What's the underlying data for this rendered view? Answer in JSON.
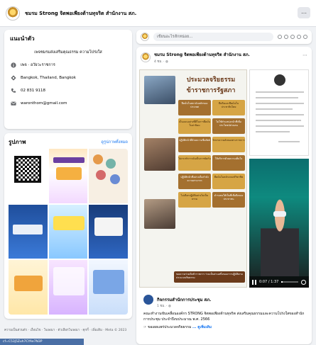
{
  "page": {
    "title": "ชมรม Strong จิตพอเพียงต้านทุจริต สำนักงาน สภ.",
    "more_icon": "more-horizontal-icon"
  },
  "intro": {
    "title": "แนะนำตัว",
    "description": "เพจชมรมส่งเสริมคุณธรรม ความโปร่งใส",
    "rows": [
      {
        "icon": "info-icon",
        "text": "เพจ · อวัยวะราชการ"
      },
      {
        "icon": "location-pin-icon",
        "text": "Bangkok, Thailand, Bangkok"
      },
      {
        "icon": "phone-icon",
        "text": "02 831 9118"
      },
      {
        "icon": "email-icon",
        "text": "waronthom@gmail.com"
      }
    ]
  },
  "photos": {
    "title": "รูปภาพ",
    "see_all": "ดูรูปภาพทั้งหมด",
    "tiles": [
      {
        "caption": ""
      },
      {
        "caption": "รายงานผลการประเมิน"
      },
      {
        "caption": ""
      },
      {
        "caption": "คู่มือการปฏิบัติงาน"
      },
      {
        "caption": "CONTENT"
      },
      {
        "caption": ""
      },
      {
        "caption": ""
      },
      {
        "caption": ""
      },
      {
        "caption": ""
      }
    ]
  },
  "footer": {
    "text": "ความเป็นส่วนตัว · เงื่อนไข · โฆษณา · ตัวเลือกโฆษณา · คุกกี้ · เพิ่มเติม · Meta © 2023",
    "url": "cf=C53j5Zuh7CYAe7N3P"
  },
  "composer": {
    "placeholder": "เขียนอะไรสักหน่อย...",
    "tools": [
      "photo-icon",
      "video-icon",
      "tag-icon",
      "emoji-icon",
      "location-icon"
    ]
  },
  "post": {
    "author": "ชมรม Strong จิตพอเพียงต้านทุจริต สำนักงาน สภ.",
    "time": "4 ชม. · ",
    "poster": {
      "title_line1": "ประมวลจริยธรรม",
      "title_line2": "ข้าราชการรัฐสภา",
      "boxes": [
        "ยึดมั่นในสถาบันหลักของประเทศ",
        "ยึดถือและยึดมั่นในประชาธิปไตย",
        "เป็นแบบอย่างที่ดีในการยึดมั่นในค่านิยม",
        "ไม่ใช้ตำแหน่งหน้าที่เพื่อประโยชน์ส่วนตน",
        "ปฏิบัติหน้าที่ด้วยความซื่อสัตย์",
        "รักษาความลับของทางราชการ",
        "ไม่กระทำการอันเป็นการขัดกัน",
        "ให้บริการด้วยความเต็มใจ",
        "ปฏิบัติหน้าที่อย่างเต็มกำลังความสามารถ",
        "ยึดมั่นในหลักเกณฑ์วิชาชีพ",
        "ไม่เลือกปฏิบัติอย่างไม่เป็นธรรม",
        "ดำรงตนให้เป็นที่เชื่อถือของประชาชน"
      ],
      "banner": "ขอความร่วมมือข้าราชการ ร่วมเป็นส่วนหนึ่งของการปฏิบัติตามประมวลจริยธรรม"
    },
    "video": {
      "time": "0:07 / 1:37",
      "progress": 0.07
    },
    "shared": {
      "author": "กิจกรรมสำนักการประชุม สภ.",
      "time": "1 ชม. · ",
      "body": "คณะทำงานขับเคลื่อนองค์กร STRONG จิตพอเพียงต้านทุจริต ส่งเสริมคุณธรรมและความโปร่งใสของสำนักการประชุม ประจำปีงบประมาณ พ.ศ. 2566",
      "link_line": "ขอเผยแพร่ประมวลจริยธรรม",
      "see_more": "... ดูเพิ่มเติม"
    }
  }
}
